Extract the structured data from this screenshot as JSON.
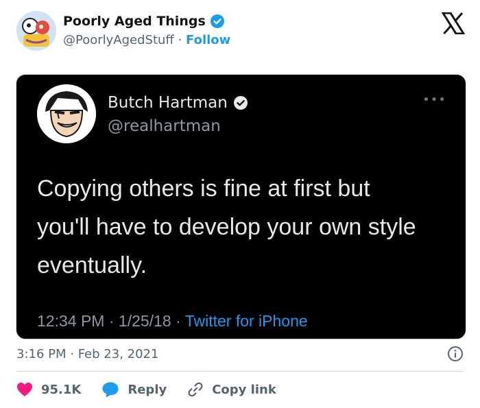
{
  "account": {
    "display_name": "Poorly Aged Things",
    "handle": "@PoorlyAgedStuff",
    "separator": "·",
    "follow_label": "Follow"
  },
  "embedded_tweet": {
    "display_name": "Butch Hartman",
    "handle": "@realhartman",
    "lines": [
      "Copying others is fine at first but",
      "you'll have to develop your own style",
      "eventually."
    ],
    "time": "12:34 PM",
    "date": "1/25/18",
    "separator": "·",
    "source": "Twitter for iPhone",
    "more_label": "•••"
  },
  "post": {
    "timestamp": "3:16 PM · Feb 23, 2021"
  },
  "actions": {
    "likes": "95.1K",
    "reply_label": "Reply",
    "copy_label": "Copy link"
  },
  "colors": {
    "accent": "#1d9bf0",
    "like": "#f91880",
    "verified": "#1d9bf0"
  }
}
